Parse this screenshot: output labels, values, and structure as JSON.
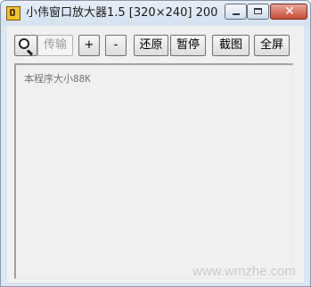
{
  "window": {
    "title": "小伟窗口放大器1.5 [320×240] 2008...",
    "buttons": {
      "minimize": "minimize",
      "maximize": "maximize",
      "close": "✕"
    }
  },
  "toolbar": {
    "magnifier_icon": "magnifier-icon",
    "transfer_label": "传输",
    "zoom_in_label": "+",
    "zoom_out_label": "-",
    "restore_label": "还原",
    "pause_label": "暂停",
    "screenshot_label": "截图",
    "fullscreen_label": "全屏"
  },
  "main": {
    "size_note": "本程序大小88K",
    "watermark": "www.wmzhe.com"
  }
}
